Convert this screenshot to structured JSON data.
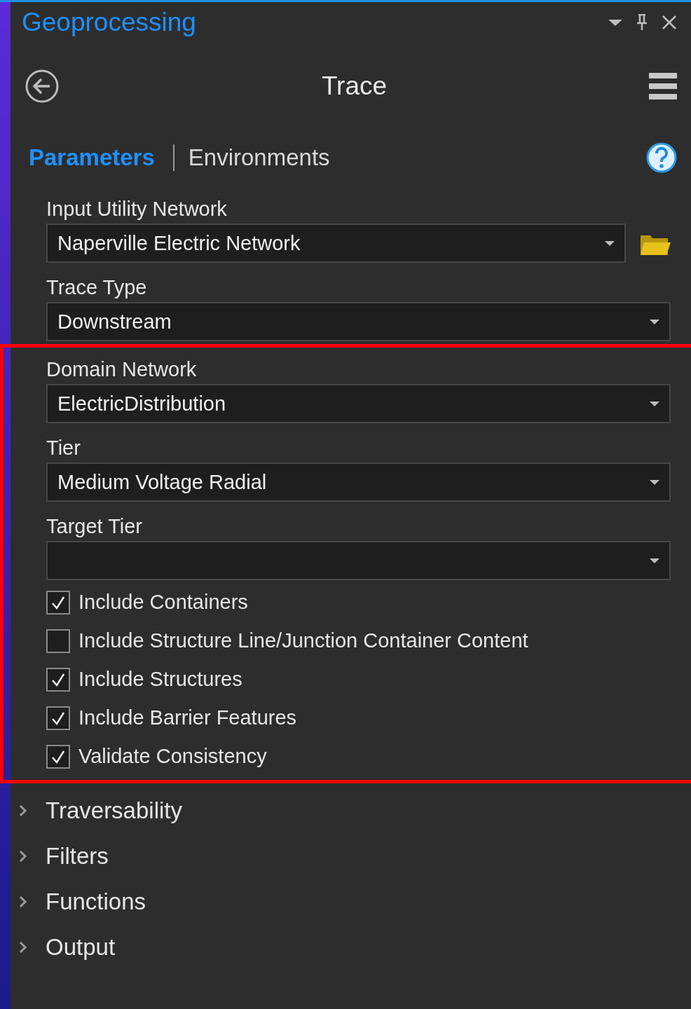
{
  "panel": {
    "title": "Geoprocessing"
  },
  "tool": {
    "title": "Trace"
  },
  "tabs": [
    {
      "label": "Parameters",
      "selected": true
    },
    {
      "label": "Environments",
      "selected": false
    }
  ],
  "parameters": [
    {
      "kind": "dropdown",
      "label": "Input Utility Network",
      "value": "Naperville Electric Network",
      "browse": true
    },
    {
      "kind": "dropdown",
      "label": "Trace Type",
      "value": "Downstream"
    }
  ],
  "highlighted_parameters": [
    {
      "kind": "dropdown",
      "label": "Domain Network",
      "value": "ElectricDistribution"
    },
    {
      "kind": "dropdown",
      "label": "Tier",
      "value": "Medium Voltage Radial"
    },
    {
      "kind": "dropdown",
      "label": "Target Tier"
    },
    {
      "kind": "checkbox",
      "label": "Include Containers",
      "checked": true
    },
    {
      "kind": "checkbox",
      "label": "Include Structure Line/Junction Container Content",
      "checked": false
    },
    {
      "kind": "checkbox",
      "label": "Include Structures",
      "checked": true
    },
    {
      "kind": "checkbox",
      "label": "Include Barrier Features",
      "checked": true
    },
    {
      "kind": "checkbox",
      "label": "Validate Consistency",
      "checked": true
    }
  ],
  "groups": [
    {
      "label": "Traversability",
      "expanded": false
    },
    {
      "label": "Filters",
      "expanded": false
    },
    {
      "label": "Functions",
      "expanded": false
    },
    {
      "label": "Output",
      "expanded": false
    }
  ]
}
